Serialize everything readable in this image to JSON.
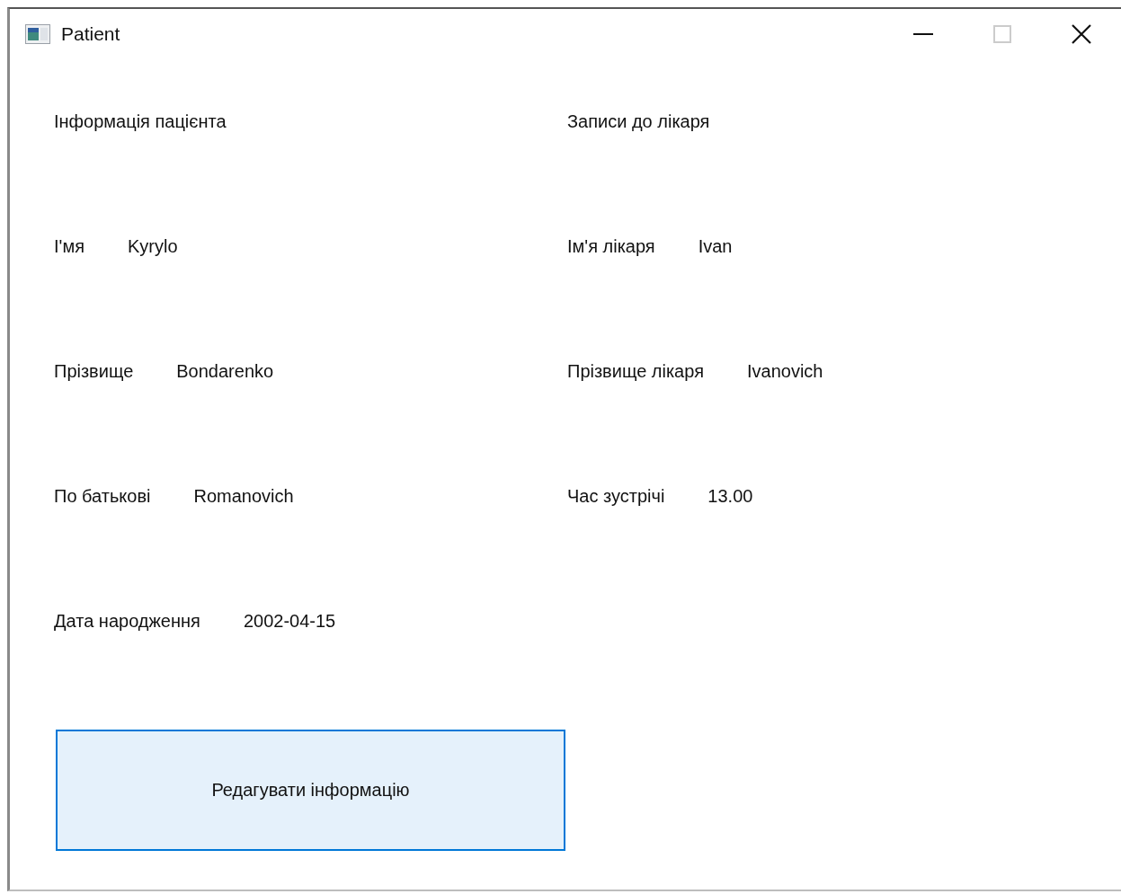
{
  "window": {
    "title": "Patient",
    "controls": [
      {
        "kind": "minimize",
        "disabled": false
      },
      {
        "kind": "maximize",
        "disabled": true
      },
      {
        "kind": "close",
        "disabled": false
      }
    ]
  },
  "patient": {
    "heading": "Інформація пацієнта",
    "fields": [
      {
        "label": "І'мя",
        "value": "Kyrylo"
      },
      {
        "label": "Прізвище",
        "value": "Bondarenko"
      },
      {
        "label": "По батькові",
        "value": "Romanovich"
      },
      {
        "label": "Дата народження",
        "value": "2002-04-15"
      }
    ]
  },
  "appointments": {
    "heading": "Записи до лікаря",
    "fields": [
      {
        "label": "Ім'я лікаря",
        "value": "Ivan"
      },
      {
        "label": "Прізвище лікаря",
        "value": "Ivanovich"
      },
      {
        "label": "Час зустрічі",
        "value": "13.00"
      }
    ]
  },
  "buttons": [
    "Редагувати інформацію"
  ]
}
